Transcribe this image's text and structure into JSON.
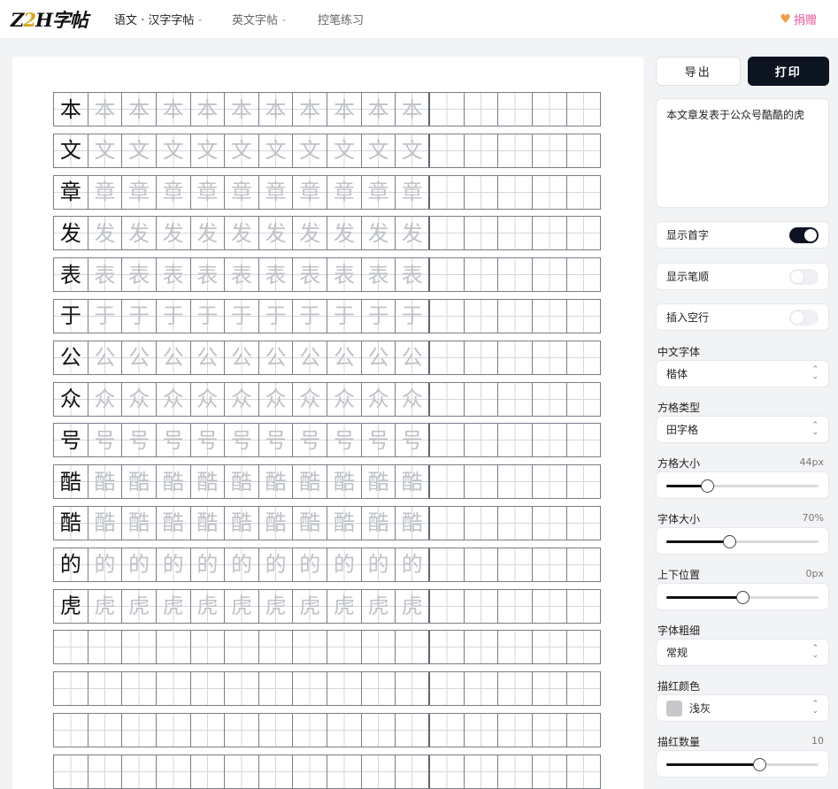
{
  "header": {
    "logo": {
      "part1": "Z",
      "accent": "2",
      "part2": "H字帖"
    },
    "nav": [
      {
        "label": "语文 · 汉字字帖",
        "active": true,
        "dropdown": true
      },
      {
        "label": "英文字帖",
        "active": false,
        "dropdown": true
      },
      {
        "label": "控笔练习",
        "active": false,
        "dropdown": false
      }
    ],
    "donate_label": "捐赠",
    "chevron": "⌄",
    "heart": "♥"
  },
  "practice_text": "本文章发表于公众号酷酷的虎",
  "sheet": {
    "rows_with_chars": [
      "本",
      "文",
      "章",
      "发",
      "表",
      "于",
      "公",
      "众",
      "号",
      "酷",
      "酷",
      "的",
      "虎"
    ],
    "empty_rows": 4,
    "columns": 16,
    "split_after_column": 11
  },
  "controls": {
    "export_label": "导出",
    "print_label": "打印",
    "toggles": [
      {
        "label": "显示首字",
        "on": true
      },
      {
        "label": "显示笔顺",
        "on": false
      },
      {
        "label": "插入空行",
        "on": false
      }
    ],
    "font_family": {
      "label": "中文字体",
      "value": "楷体"
    },
    "grid_type": {
      "label": "方格类型",
      "value": "田字格"
    },
    "grid_size": {
      "label": "方格大小",
      "value": "44px",
      "level": 0.27
    },
    "font_size": {
      "label": "字体大小",
      "value": "70%",
      "level": 0.41
    },
    "vertical_pos": {
      "label": "上下位置",
      "value": "0px",
      "level": 0.5
    },
    "font_weight": {
      "label": "字体粗细",
      "value": "常规"
    },
    "trace_color": {
      "label": "描红颜色",
      "value": "浅灰",
      "swatch": "#c6c8cc"
    },
    "trace_count": {
      "label": "描红数量",
      "value": "10",
      "level": 0.61
    }
  },
  "colors": {
    "accent_dark": "#0d1421",
    "donate": "#e0579a",
    "grid_line": "#787e87",
    "trace": "#bfc2c6"
  }
}
